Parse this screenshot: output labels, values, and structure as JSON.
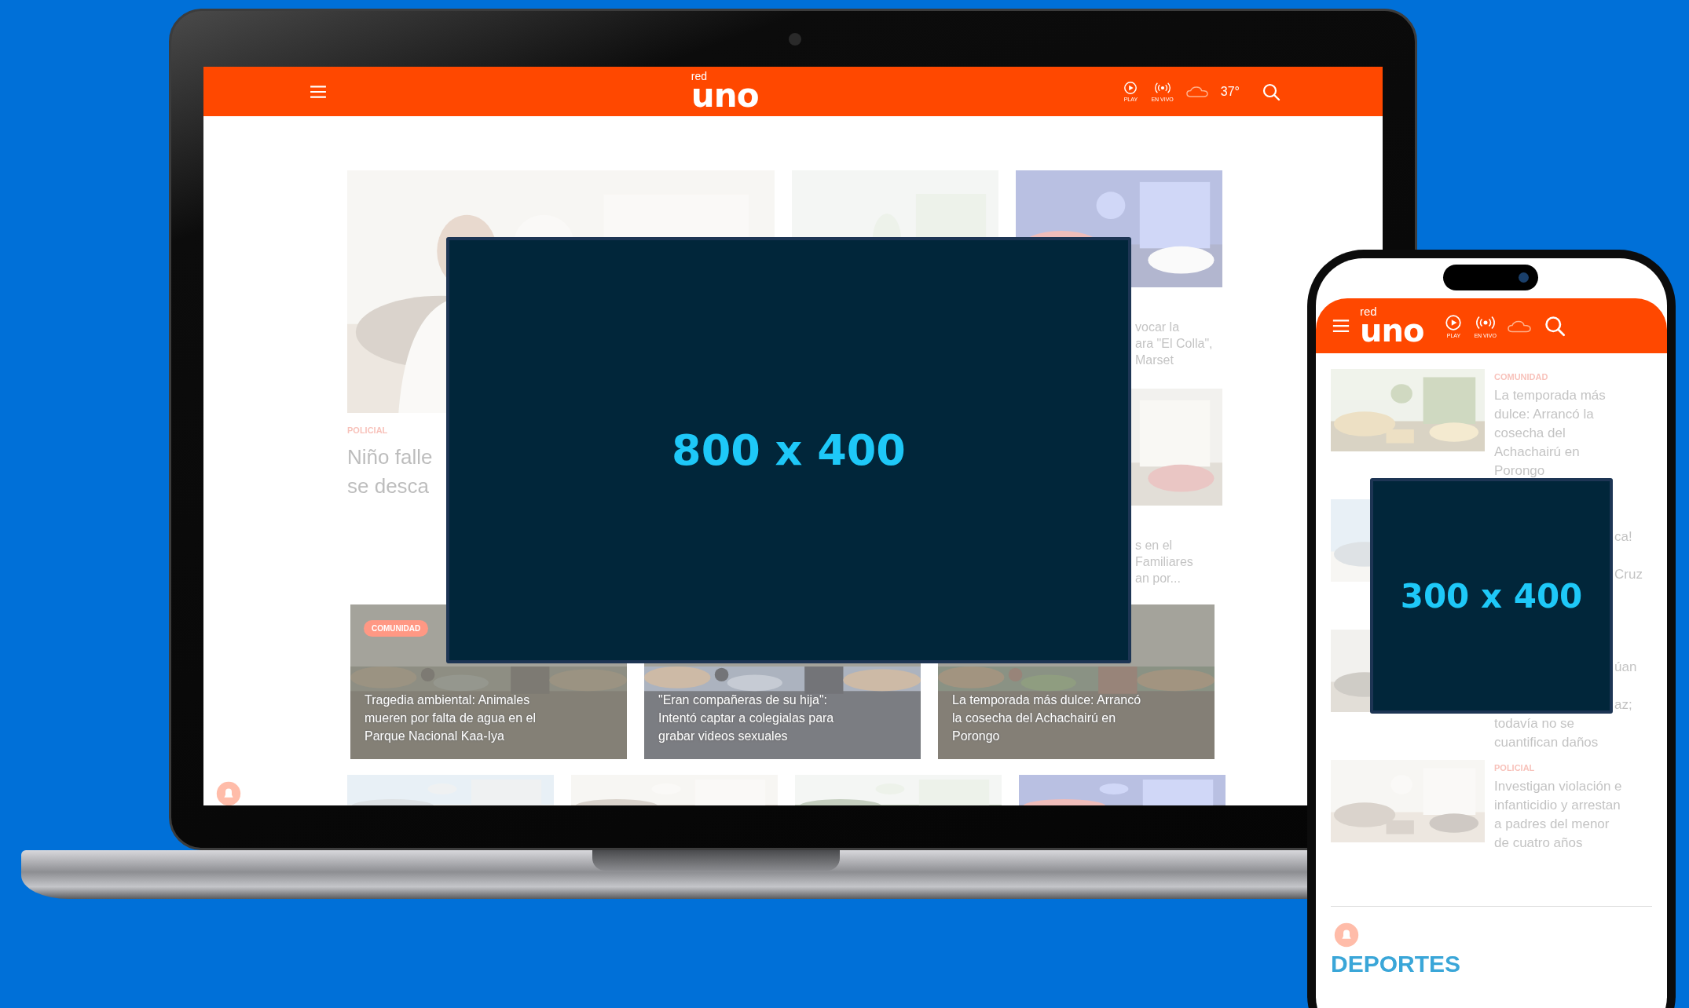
{
  "laptop": {
    "header": {
      "logo_small": "red",
      "logo_main": "uno",
      "play_label": "PLAY",
      "live_label": "EN VIVO",
      "temperature": "37°"
    },
    "lead_story": {
      "category": "POLICIAL",
      "headline": "Niño falle\nse desca"
    },
    "side_stories": [
      {
        "headline": "vocar la\nara \"El Colla\",\nMarset"
      },
      {
        "headline": "s en el\nFamiliares\nan por..."
      }
    ],
    "cards": [
      {
        "badge": "COMUNIDAD",
        "headline": "Tragedia ambiental: Animales\nmueren por falta de agua en el\nParque Nacional Kaa-Iya"
      },
      {
        "headline": "\"Eran compañeras de su hija\":\nIntentó captar a colegialas para\ngrabar videos sexuales"
      },
      {
        "headline": "La temporada más dulce: Arrancó\nla cosecha del Achachairú en\nPorongo"
      }
    ],
    "ad": {
      "label": "800 x 400"
    }
  },
  "phone": {
    "header": {
      "logo_small": "red",
      "logo_main": "uno",
      "play_label": "PLAY",
      "live_label": "EN VIVO"
    },
    "stories": [
      {
        "category": "COMUNIDAD",
        "headline": "La temporada más\ndulce: Arrancó la\ncosecha del\nAchachairú en\nPorongo"
      },
      {
        "fragments": [
          "ca!",
          "Cruz"
        ]
      },
      {
        "fragments": [
          "úan",
          "az;"
        ],
        "headline": "todavía no se\ncuantifican daños"
      },
      {
        "category": "POLICIAL",
        "headline": "Investigan violación e\ninfanticidio y arrestan\na padres del menor\nde cuatro años"
      }
    ],
    "section_title": "DEPORTES",
    "ad": {
      "label": "300 x 400"
    }
  }
}
